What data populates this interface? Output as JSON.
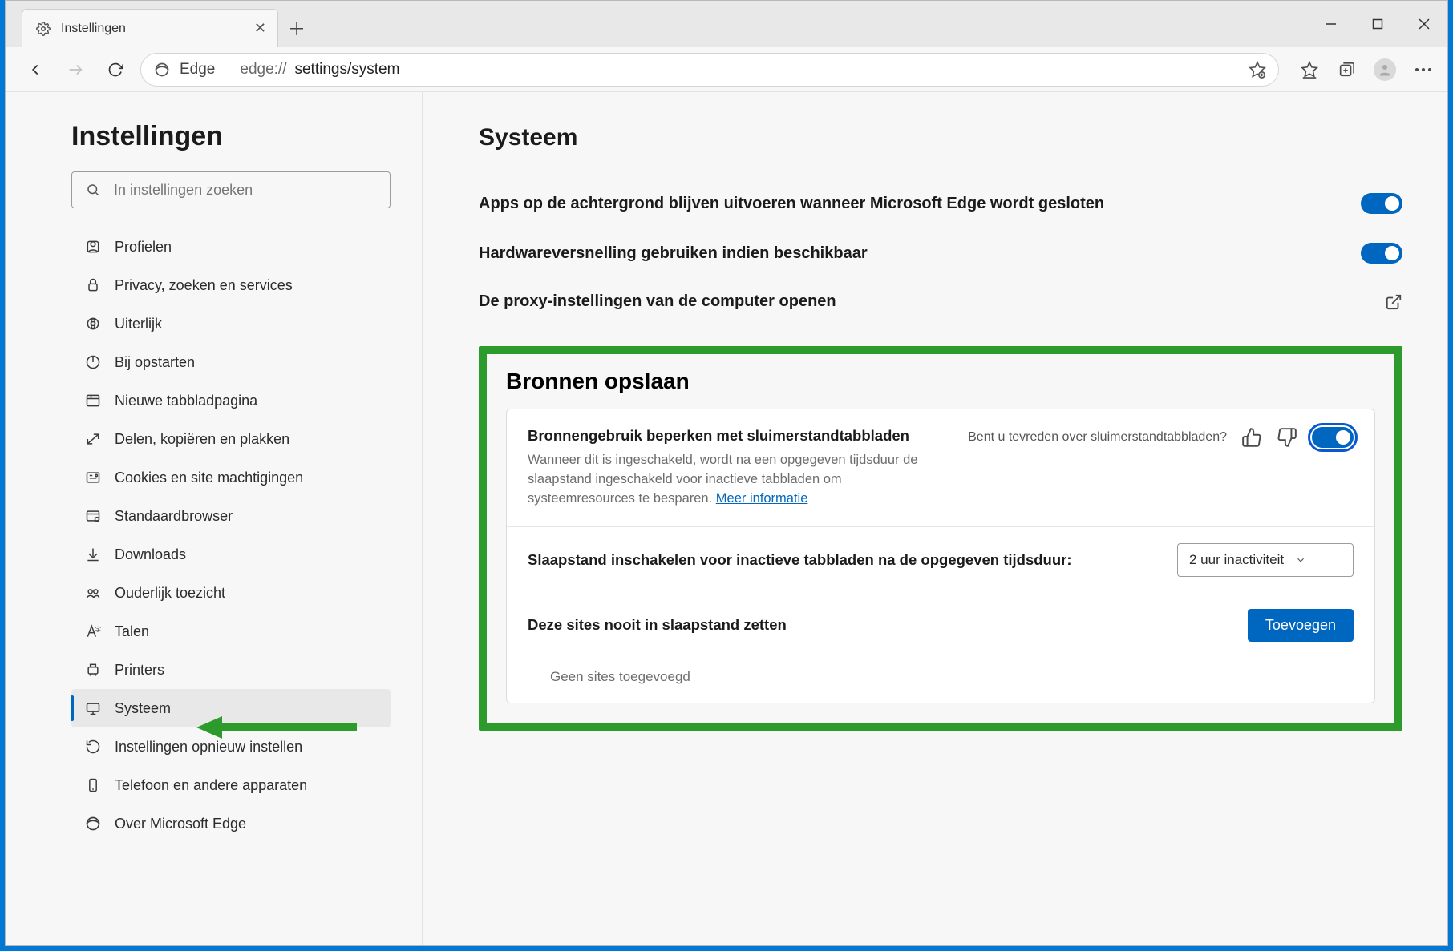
{
  "tab": {
    "title": "Instellingen"
  },
  "addr": {
    "brand": "Edge",
    "url_prefix": "edge://",
    "url_dark": "settings/system"
  },
  "sidebar": {
    "title": "Instellingen",
    "search_placeholder": "In instellingen zoeken",
    "items": [
      {
        "label": "Profielen"
      },
      {
        "label": "Privacy, zoeken en services"
      },
      {
        "label": "Uiterlijk"
      },
      {
        "label": "Bij opstarten"
      },
      {
        "label": "Nieuwe tabbladpagina"
      },
      {
        "label": "Delen, kopiëren en plakken"
      },
      {
        "label": "Cookies en site machtigingen"
      },
      {
        "label": "Standaardbrowser"
      },
      {
        "label": "Downloads"
      },
      {
        "label": "Ouderlijk toezicht"
      },
      {
        "label": "Talen"
      },
      {
        "label": "Printers"
      },
      {
        "label": "Systeem"
      },
      {
        "label": "Instellingen opnieuw instellen"
      },
      {
        "label": "Telefoon en andere apparaten"
      },
      {
        "label": "Over Microsoft Edge"
      }
    ],
    "active_index": 12
  },
  "page": {
    "title": "Systeem",
    "rows": [
      {
        "label": "Apps op de achtergrond blijven uitvoeren wanneer Microsoft Edge wordt gesloten",
        "toggle": true
      },
      {
        "label": "Hardwareversnelling gebruiken indien beschikbaar",
        "toggle": true
      },
      {
        "label": "De proxy-instellingen van de computer openen",
        "external": true
      }
    ],
    "section": {
      "title": "Bronnen opslaan",
      "sleep": {
        "title": "Bronnengebruik beperken met sluimerstandtabbladen",
        "desc_part1": "Wanneer dit is ingeschakeld, wordt na een opgegeven tijdsduur de slaapstand ingeschakeld voor inactieve tabbladen om systeemresources te besparen. ",
        "link": "Meer informatie",
        "feedback_q": "Bent u tevreden over sluimerstandtabbladen?",
        "toggle": true
      },
      "timeout": {
        "label": "Slaapstand inschakelen voor inactieve tabbladen na de opgegeven tijdsduur:",
        "value": "2 uur inactiviteit"
      },
      "never": {
        "label": "Deze sites nooit in slaapstand zetten",
        "button": "Toevoegen",
        "empty": "Geen sites toegevoegd"
      }
    }
  }
}
